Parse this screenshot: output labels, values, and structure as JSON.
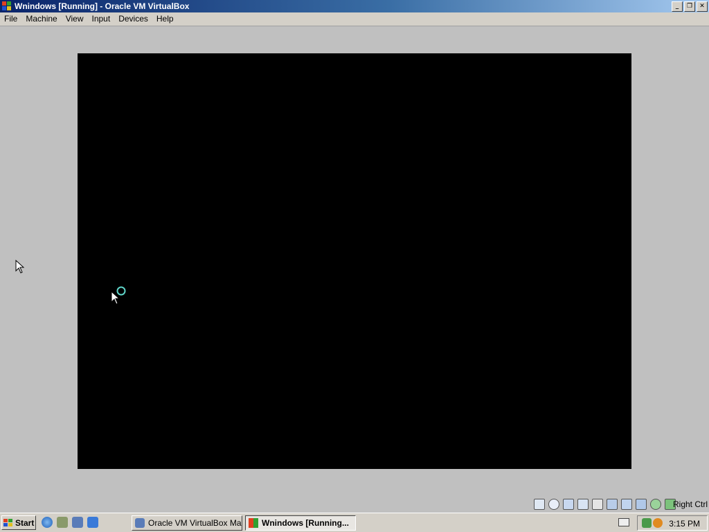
{
  "window": {
    "title": "Wnindows  [Running] - Oracle VM VirtualBox",
    "minimize": "_",
    "restore": "❐",
    "close": "✕"
  },
  "menu": [
    "File",
    "Machine",
    "View",
    "Input",
    "Devices",
    "Help"
  ],
  "statusbar": {
    "host_key": "Right Ctrl",
    "icons": [
      "hard-disk-icon",
      "optical-drive-icon",
      "network-icon",
      "usb-icon",
      "shared-folders-icon",
      "display-icon",
      "video-capture-icon",
      "virtualization-icon",
      "mouse-integration-icon",
      "download-icon"
    ]
  },
  "taskbar": {
    "start_label": "Start",
    "quick_launch": [
      "internet-explorer-icon",
      "desktop-icon",
      "virtualbox-icon",
      "windows-update-icon"
    ],
    "tasks": [
      {
        "label": "Oracle VM VirtualBox Ma...",
        "active": false
      },
      {
        "label": "Wnindows  [Running...",
        "active": true
      }
    ],
    "clock": "3:15 PM"
  },
  "colors": {
    "title_start": "#0a246a",
    "title_end": "#a6caf0",
    "vm_screen": "#000000",
    "desktop": "#c0c0c0",
    "busy_ring": "#5fd4c8"
  }
}
